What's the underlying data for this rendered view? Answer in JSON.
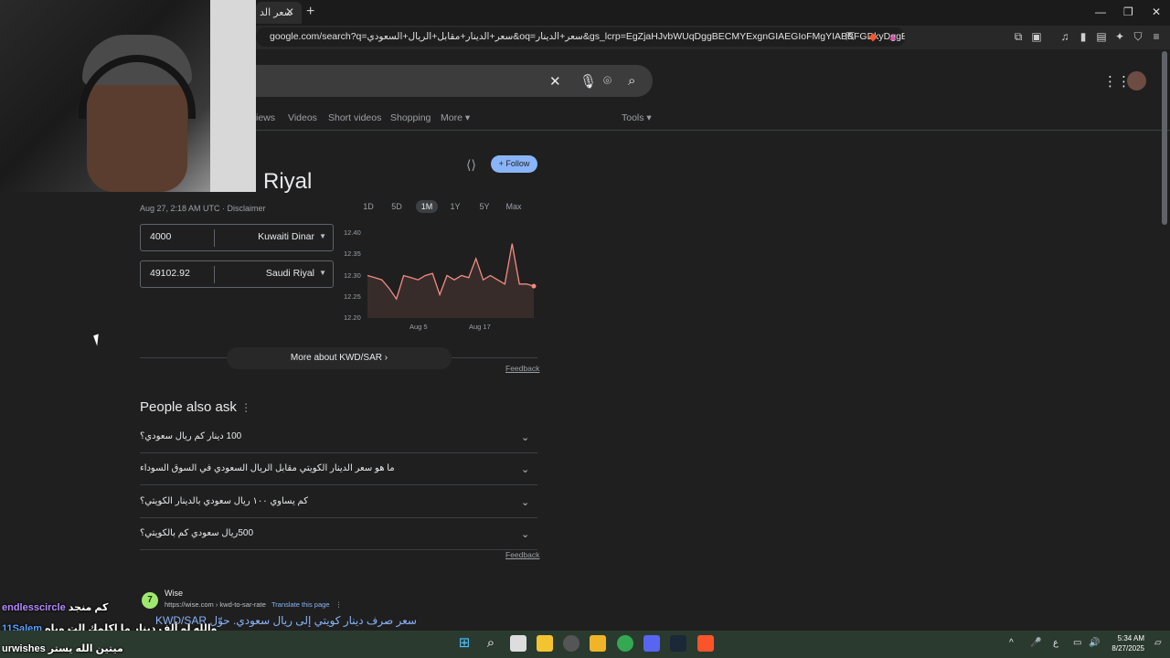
{
  "browser": {
    "tab_title": "سعر الد",
    "url": "google.com/search?q=سعر+الدينار+مقابل+الريال+السعودي&oq=سعر+الدينار&gs_lcrp=EgZjaHJvbWUqDggBECMYExgnGIAEGIoFMgYIABBFGDkyDggBECMYEx...",
    "close_glyph": "✕",
    "new_tab_glyph": "+",
    "win_min": "—",
    "win_max": "❐",
    "win_close": "✕"
  },
  "search": {
    "nav_tabs": [
      "News",
      "Videos",
      "Short videos",
      "Shopping",
      "More",
      "Tools"
    ],
    "nav_tab_partial": "iews"
  },
  "converter": {
    "title": "Riyal",
    "follow_label": "Follow",
    "timestamp": "Aug 27, 2:18 AM UTC · Disclaimer",
    "ranges": [
      "1D",
      "5D",
      "1M",
      "1Y",
      "5Y",
      "Max"
    ],
    "active_range": "1M",
    "from": {
      "value": "4000",
      "currency": "Kuwaiti Dinar"
    },
    "to": {
      "value": "49102.92",
      "currency": "Saudi Riyal"
    },
    "more_label": "More about KWD/SAR",
    "feedback": "Feedback"
  },
  "chart_data": {
    "type": "line",
    "title": "",
    "xlabel": "",
    "ylabel": "",
    "ylim": [
      12.2,
      12.4
    ],
    "yticks": [
      "12.40",
      "12.35",
      "12.30",
      "12.25",
      "12.20"
    ],
    "xticks": [
      {
        "label": "Aug 5",
        "index": 8
      },
      {
        "label": "Aug 17",
        "index": 18
      }
    ],
    "values": [
      12.3,
      12.295,
      12.29,
      12.27,
      12.245,
      12.3,
      12.295,
      12.29,
      12.3,
      12.305,
      12.255,
      12.3,
      12.29,
      12.3,
      12.295,
      12.34,
      12.29,
      12.3,
      12.29,
      12.28,
      12.375,
      12.28,
      12.28,
      12.275
    ],
    "color": "#f28b82",
    "grid": false
  },
  "paa": {
    "title": "People also ask",
    "questions": [
      "100 دينار كم ريال سعودي؟",
      "ما هو سعر الدينار الكويتي مقابل الريال السعودي في السوق السوداء",
      "كم يساوي ١٠٠ ريال سعودي بالدينار الكويتي؟",
      "500ريال سعودي كم بالكويتي؟"
    ],
    "feedback": "Feedback"
  },
  "result": {
    "site_name": "Wise",
    "url": "https://wise.com › kwd-to-sar-rate",
    "translate": "Translate this page",
    "heading": "سعر صرف دينار كويتي إلى ريال سعودي. حوّل KWD/SAR"
  },
  "chat": [
    {
      "user": "endlesscircle",
      "msg": "كم منجد",
      "color": "#b48cff"
    },
    {
      "user": "11Salem",
      "msg": "والله لو ألف دينار ما اكلمك الت وياه",
      "color": "#5aa0ff"
    },
    {
      "user": "urwishes",
      "msg": "ميتين الله يستر",
      "color": "#ffffff"
    }
  ],
  "taskbar": {
    "time": "5:34 AM",
    "date": "8/27/2025",
    "lang": "ع"
  }
}
